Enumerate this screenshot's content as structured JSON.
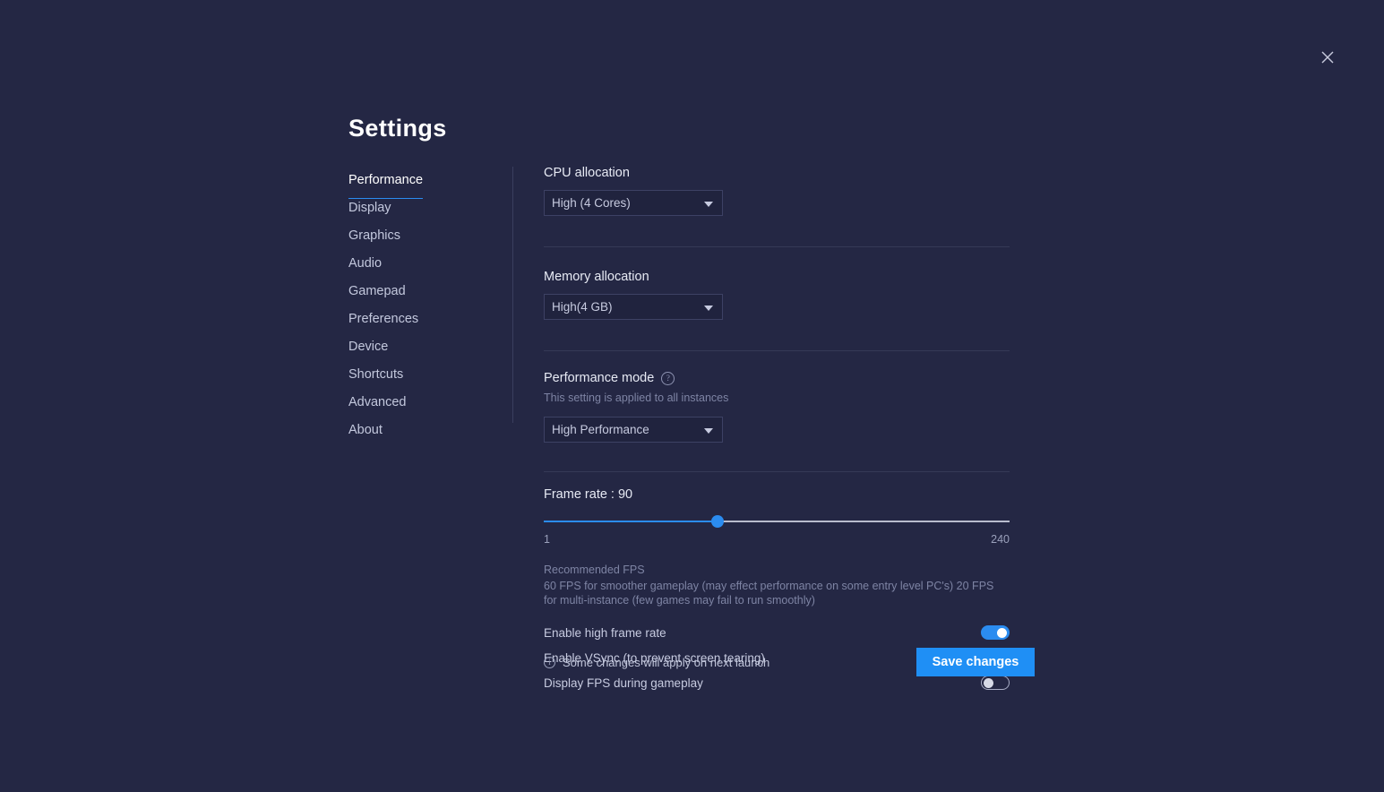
{
  "window": {
    "title": "Settings",
    "close_icon": "close-icon",
    "background_color": "#242744",
    "accent_color": "#2b8cf0"
  },
  "sidebar": {
    "items": [
      {
        "label": "Performance",
        "active": true
      },
      {
        "label": "Display",
        "active": false
      },
      {
        "label": "Graphics",
        "active": false
      },
      {
        "label": "Audio",
        "active": false
      },
      {
        "label": "Gamepad",
        "active": false
      },
      {
        "label": "Preferences",
        "active": false
      },
      {
        "label": "Device",
        "active": false
      },
      {
        "label": "Shortcuts",
        "active": false
      },
      {
        "label": "Advanced",
        "active": false
      },
      {
        "label": "About",
        "active": false
      }
    ]
  },
  "main": {
    "cpu": {
      "label": "CPU allocation",
      "value": "High (4 Cores)",
      "caret_icon": "chevron-down-icon"
    },
    "memory": {
      "label": "Memory allocation",
      "value": "High(4 GB)",
      "caret_icon": "chevron-down-icon"
    },
    "performance_mode": {
      "label": "Performance mode",
      "help_icon": "help-circle-icon",
      "note": "This setting is applied to all instances",
      "value": "High Performance",
      "caret_icon": "chevron-down-icon"
    },
    "frame_rate": {
      "label": "Frame rate : 90",
      "value": 90,
      "min": 1,
      "max": 240,
      "min_label": "1",
      "max_label": "240",
      "fill_percent": "37.7%"
    },
    "recommended": {
      "title": "Recommended FPS",
      "body": "60 FPS for smoother gameplay (may effect performance on some entry level PC's) 20 FPS for multi-instance (few games may fail to run smoothly)"
    },
    "toggles": [
      {
        "label": "Enable high frame rate",
        "state": "on"
      },
      {
        "label": "Enable VSync (to prevent screen tearing)",
        "state": "off"
      },
      {
        "label": "Display FPS during gameplay",
        "state": "off"
      }
    ]
  },
  "footer": {
    "info_icon": "info-circle-icon",
    "note": "Some changes will apply on next launch",
    "save_label": "Save changes"
  }
}
